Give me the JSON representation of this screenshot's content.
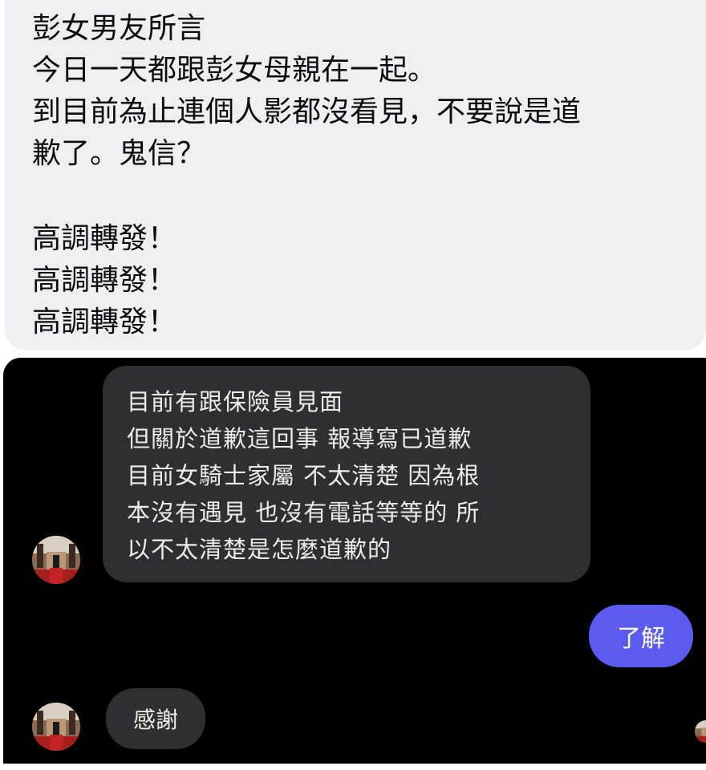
{
  "post": {
    "lines": [
      "彭女男友所言",
      "今日一天都跟彭女母親在一起。",
      "到目前為止連個人影都沒看見，不要說是道",
      "歉了。鬼信？",
      "高調轉發！",
      "高調轉發！",
      "高調轉發！"
    ]
  },
  "chat": {
    "incoming_1": {
      "lines": [
        "目前有跟保險員見面",
        "但關於道歉這回事 報導寫已道歉",
        "目前女騎士家屬 不太清楚 因為根",
        "本沒有遇見 也沒有電話等等的 所",
        "以不太清楚是怎麼道歉的"
      ]
    },
    "outgoing_1": {
      "text": "了解"
    },
    "incoming_2": {
      "text": "感謝"
    }
  },
  "colors": {
    "post_background": "#efeff3",
    "chat_background": "#000000",
    "incoming_bubble": "#2f2f31",
    "outgoing_bubble": "#5b5bf0"
  }
}
